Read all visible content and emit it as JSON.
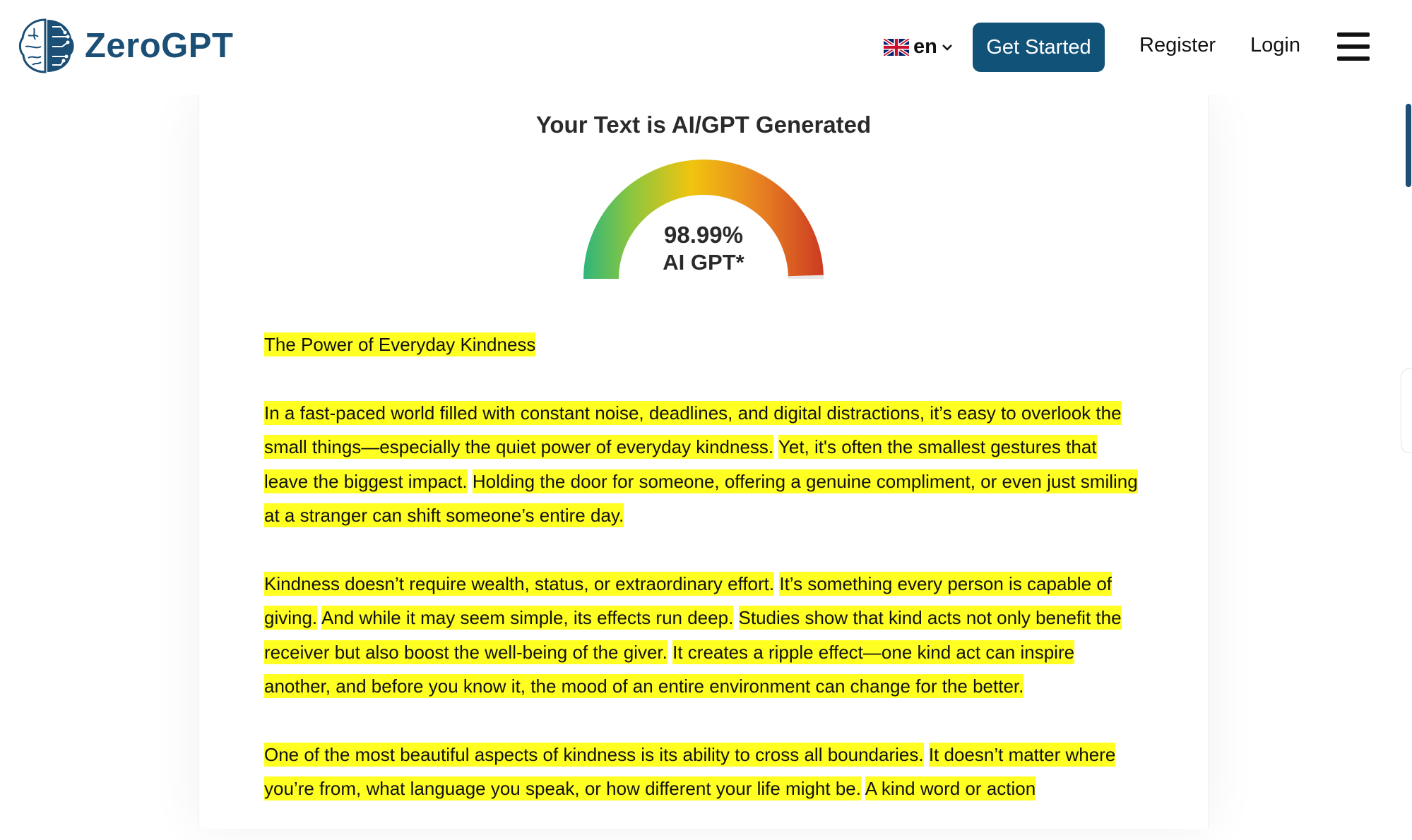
{
  "header": {
    "logo_text": "ZeroGPT",
    "language": "en",
    "get_started": "Get Started",
    "register": "Register",
    "login": "Login"
  },
  "result": {
    "title": "Your Text is AI/GPT Generated",
    "percentage": "98.99%",
    "label": "AI GPT*",
    "ai_score": 0.9899
  },
  "document": {
    "heading": "The Power of Everyday Kindness",
    "paragraphs": [
      [
        "In a fast-paced world filled with constant noise, deadlines, and digital distractions, it’s easy to overlook the small things—especially the quiet power of everyday kindness.",
        "Yet, it's often the smallest gestures that leave the biggest impact.",
        "Holding the door for someone, offering a genuine compliment, or even just smiling at a stranger can shift someone’s entire day."
      ],
      [
        "Kindness doesn’t require wealth, status, or extraordinary effort.",
        "It’s something every person is capable of giving.",
        "And while it may seem simple, its effects run deep.",
        "Studies show that kind acts not only benefit the receiver but also boost the well-being of the giver.",
        "It creates a ripple effect—one kind act can inspire another, and before you know it, the mood of an entire environment can change for the better."
      ],
      [
        "One of the most beautiful aspects of kindness is its ability to cross all boundaries.",
        "It doesn’t matter where you’re from, what language you speak, or how different your life might be.",
        "A kind word or action"
      ]
    ]
  },
  "colors": {
    "brand": "#1b4f76",
    "button": "#115279",
    "highlight": "#ffff22"
  }
}
